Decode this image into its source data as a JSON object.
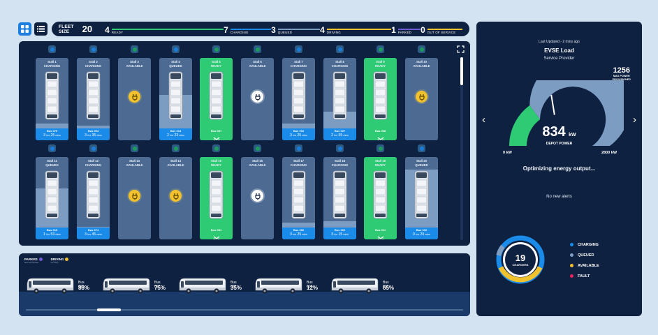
{
  "view_toggle": {
    "grid_icon": "grid-icon",
    "list_icon": "list-icon"
  },
  "fleet": {
    "label": "FLEET SIZE",
    "size": "20",
    "stats": [
      {
        "count": "4",
        "label": "READY",
        "color": "#2fcb74"
      },
      {
        "count": "7",
        "label": "CHARGING",
        "color": "#1a8be8"
      },
      {
        "count": "3",
        "label": "QUEUED",
        "color": "#7c9cc2"
      },
      {
        "count": "4",
        "label": "DRIVING",
        "color": "#f2c12e"
      },
      {
        "count": "1",
        "label": "PARKED",
        "color": "#6f5bd6"
      },
      {
        "count": "0",
        "label": "OUT OF SERVICE",
        "color": "#f2c12e"
      }
    ]
  },
  "stalls": [
    {
      "title": "Stall 1",
      "status": "CHARGING",
      "bus": "Bus 079",
      "eta_h": "3",
      "eta_m": "25",
      "fill": 0.2
    },
    {
      "title": "Stall 2",
      "status": "CHARGING",
      "bus": "Bus 004",
      "eta_h": "3",
      "eta_m": "35",
      "fill": 0.18
    },
    {
      "title": "Stall 3",
      "status": "AVAILABLE",
      "bus": "",
      "eta_h": "",
      "eta_m": "",
      "fill": 0
    },
    {
      "title": "Stall 4",
      "status": "QUEUED",
      "bus": "Bus 013",
      "eta_h": "2",
      "eta_m": "23",
      "fill": 0.55
    },
    {
      "title": "Stall 5",
      "status": "READY",
      "bus": "Bus 007",
      "eta_h": "",
      "eta_m": "",
      "fill": 1
    },
    {
      "title": "Stall 6",
      "status": "AVAILABLE",
      "bus": "",
      "eta_h": "",
      "eta_m": "",
      "fill": 0
    },
    {
      "title": "Stall 7",
      "status": "CHARGING",
      "bus": "Bus 002",
      "eta_h": "3",
      "eta_m": "25",
      "fill": 0.2
    },
    {
      "title": "Stall 8",
      "status": "CHARGING",
      "bus": "Bus 007",
      "eta_h": "2",
      "eta_m": "55",
      "fill": 0.35
    },
    {
      "title": "Stall 9",
      "status": "READY",
      "bus": "Bus 008",
      "eta_h": "",
      "eta_m": "",
      "fill": 1
    },
    {
      "title": "Stall 10",
      "status": "AVAILABLE",
      "bus": "",
      "eta_h": "",
      "eta_m": "",
      "fill": 0
    },
    {
      "title": "Stall 11",
      "status": "QUEUED",
      "bus": "Bus 015",
      "eta_h": "1",
      "eta_m": "53",
      "fill": 0.62
    },
    {
      "title": "Stall 12",
      "status": "CHARGING",
      "bus": "Bus 074",
      "eta_h": "3",
      "eta_m": "45",
      "fill": 0.15
    },
    {
      "title": "Stall 13",
      "status": "AVAILABLE",
      "bus": "",
      "eta_h": "",
      "eta_m": "",
      "fill": 0
    },
    {
      "title": "Stall 14",
      "status": "AVAILABLE",
      "bus": "",
      "eta_h": "",
      "eta_m": "",
      "fill": 0
    },
    {
      "title": "Stall 15",
      "status": "READY",
      "bus": "Bus 001",
      "eta_h": "",
      "eta_m": "",
      "fill": 1
    },
    {
      "title": "Stall 16",
      "status": "AVAILABLE",
      "bus": "",
      "eta_h": "",
      "eta_m": "",
      "fill": 0
    },
    {
      "title": "Stall 17",
      "status": "CHARGING",
      "bus": "Bus 006",
      "eta_h": "3",
      "eta_m": "25",
      "fill": 0.2
    },
    {
      "title": "Stall 18",
      "status": "CHARGING",
      "bus": "Bus 002",
      "eta_h": "3",
      "eta_m": "15",
      "fill": 0.22
    },
    {
      "title": "Stall 19",
      "status": "READY",
      "bus": "Bus 011",
      "eta_h": "",
      "eta_m": "",
      "fill": 1
    },
    {
      "title": "Stall 20",
      "status": "QUEUED",
      "bus": "Bus 016",
      "eta_h": "0",
      "eta_m": "20",
      "fill": 0.85
    }
  ],
  "eta_units": {
    "hrs": "hrs",
    "mins": "mins"
  },
  "driving_panel": {
    "parked_label": "PARKED",
    "parked_sub": "Not Connected",
    "driving_label": "DRIVING",
    "driving_sub": "On Duty",
    "buses": [
      {
        "name": "Bus 015",
        "soc": "88%"
      },
      {
        "name": "Bus 017",
        "soc": "75%"
      },
      {
        "name": "Bus 020",
        "soc": "35%"
      },
      {
        "name": "Bus 014",
        "soc": "12%"
      },
      {
        "name": "Bus 019",
        "soc": "65%"
      }
    ]
  },
  "evse": {
    "updated": "Last Updated - 2 mins ago",
    "title": "EVSE Load",
    "subtitle": "Service Provider",
    "max_value": "1256",
    "max_label_1": "MAX POWER",
    "max_label_2": "PROVISIONED",
    "power_value": "834",
    "power_unit": "kW",
    "power_label": "DEPOT POWER",
    "min_label": "0 kW",
    "max_scale_label": "2800 kW",
    "power_fraction": 0.298,
    "provisioned_fraction": 0.449,
    "status": "Optimizing energy output...",
    "alerts": "No new alerts",
    "chargers_count": "19",
    "chargers_label": "CHARGERS",
    "legend": [
      {
        "label": "CHARGING",
        "color": "#1a8be8"
      },
      {
        "label": "QUEUED",
        "color": "#7c9cc2"
      },
      {
        "label": "AVAILABLE",
        "color": "#f2c12e"
      },
      {
        "label": "FAULT",
        "color": "#e8245e"
      }
    ]
  }
}
